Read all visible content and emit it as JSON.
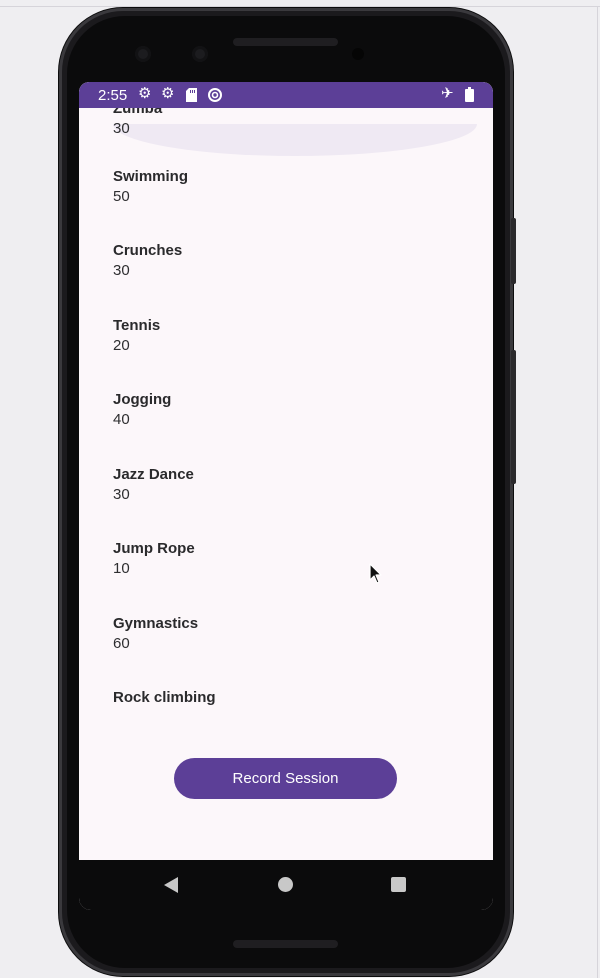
{
  "status_bar": {
    "time": "2:55",
    "left_icons": [
      "gear-icon",
      "gear-icon",
      "sd-card-icon",
      "sync-icon"
    ],
    "right_icons": [
      "airplane-mode-icon",
      "battery-icon"
    ]
  },
  "activities": [
    {
      "name": "Zumba",
      "value": "30"
    },
    {
      "name": "Swimming",
      "value": "50"
    },
    {
      "name": "Crunches",
      "value": "30"
    },
    {
      "name": "Tennis",
      "value": "20"
    },
    {
      "name": "Jogging",
      "value": "40"
    },
    {
      "name": "Jazz Dance",
      "value": "30"
    },
    {
      "name": "Jump Rope",
      "value": "10"
    },
    {
      "name": "Gymnastics",
      "value": "60"
    },
    {
      "name": "Rock climbing",
      "value": ""
    }
  ],
  "record_button_label": "Record Session",
  "colors": {
    "accent": "#5c3f97",
    "screen_background": "#fcf7fa",
    "overscroll_glow": "#efe9f3"
  }
}
